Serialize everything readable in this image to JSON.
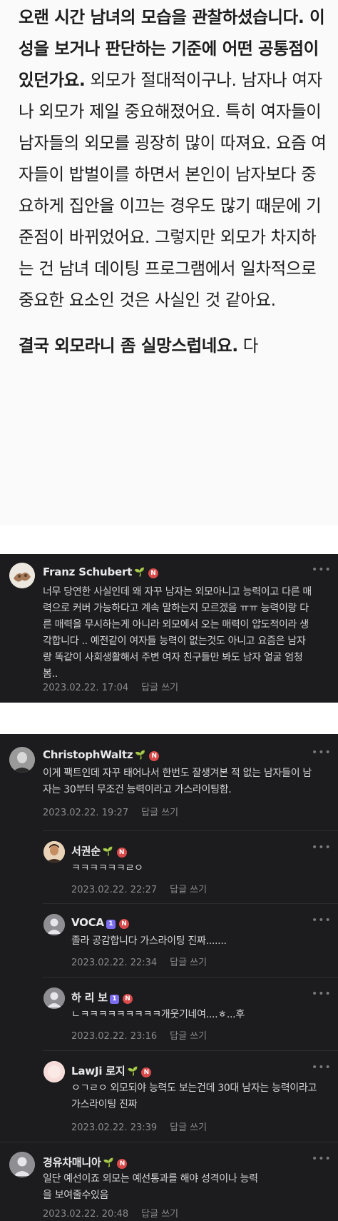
{
  "article": {
    "p1_bold": "오랜 시간 남녀의 모습을 관찰하셨습니다. 이성을 보거나 판단하는 기준에 어떤 공통점이 있던가요.",
    "p1_rest": " 외모가 절대적이구나. 남자나 여자나 외모가 제일 중요해졌어요. 특히 여자들이 남자들의 외모를 굉장히 많이 따져요. 요즘 여자들이 밥벌이를 하면서 본인이 남자보다 중요하게 집안을 이끄는 경우도 많기 때문에 기준점이 바뀌었어요. 그렇지만 외모가 차지하는 건 남녀 데이팅 프로그램에서 일차적으로 중요한 요소인 것은 사실인 것 같아요.",
    "p2_bold": "결국 외모라니 좀 실망스럽네요.",
    "p2_rest": " 다"
  },
  "comments": [
    {
      "user": "Franz Schubert",
      "text": "너무 당연한 사실인데 왜 자꾸 남자는 외모아니고 능력이고 다른 매력으로 커버 가능하다고 계속 말하는지 모르겠음 ㅠㅠ 능력이랑 다른 매력을 무시하는게 아니라 외모에서 오는 매력이 압도적이라 생각합니다 .. 예전같이 여자들 능력이 없는것도 아니고 요즘은 남자랑 똑같이 사회생활해서 주변 여자 친구들만 봐도 남자 얼굴 엄청봄..",
      "date": "2023.02.22. 17:04",
      "reply": "답글 쓰기"
    },
    {
      "user": "ChristophWaltz",
      "text": "이게 팩트인데 자꾸 태어나서 한번도 잘생겨본 적 없는 남자들이 남자는 30부터 무조건 능력이라고 가스라이팅함.",
      "date": "2023.02.22. 19:27",
      "reply": "답글 쓰기"
    },
    {
      "user": "서권순",
      "text": "ㅋㅋㅋㅋㅋㅋㄹㅇ",
      "date": "2023.02.22. 22:27",
      "reply": "답글 쓰기"
    },
    {
      "user": "VOCA",
      "text": "졸라 공감합니다 가스라이팅 진짜.......",
      "date": "2023.02.22. 22:34",
      "reply": "답글 쓰기"
    },
    {
      "user": "하 리 보",
      "text": "ㄴㅋㅋㅋㅋㅋㅋㅋㅋㅋ개웃기네여....ㅎ...후",
      "date": "2023.02.22. 23:16",
      "reply": "답글 쓰기"
    },
    {
      "user": "LawJi 로지",
      "text": "ㅇㄱㄹㅇ 외모되야 능력도 보는건데 30대 남자는 능력이라고 가스라이팅 진짜",
      "date": "2023.02.22. 23:39",
      "reply": "답글 쓰기"
    },
    {
      "user": "경유차매니아",
      "text": "일단 예선이죠 외모는 예선통과를 해야 성격이나 능력을 보여줄수있음",
      "date": "2023.02.22. 20:48",
      "reply": "답글 쓰기"
    }
  ],
  "icons": {
    "leaf": "🌱",
    "badge_n": "N",
    "badge_level": "1",
    "more": "•••"
  },
  "colors": {
    "panel_bg": "#1c1c1e",
    "leaf": "#4cc35a",
    "badge_n": "#d94a4a",
    "badge_level": "#7b6cf0"
  }
}
